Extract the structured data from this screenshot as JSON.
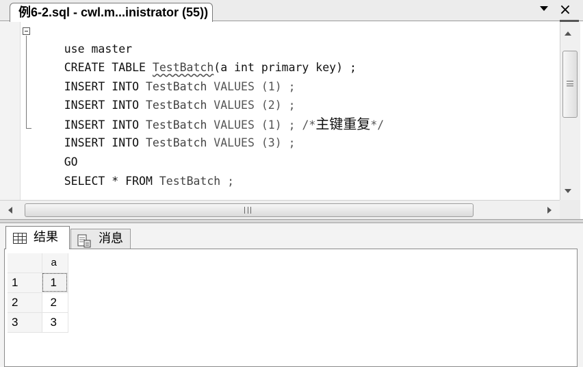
{
  "document_tab": {
    "title": "例6-2.sql - cwl.m...inistrator (55))"
  },
  "editor": {
    "lines": [
      {
        "kw": "use master"
      },
      {
        "kw": "CREATE TABLE ",
        "ident": "TestBatch",
        "rest": "(a int primary key) ;"
      },
      {
        "kw": "INSERT INTO ",
        "ident": "TestBatch",
        "rest": " VALUES (1) ;"
      },
      {
        "kw": "INSERT INTO ",
        "ident": "TestBatch",
        "rest": " VALUES (2) ;"
      },
      {
        "kw": "INSERT INTO ",
        "ident": "TestBatch",
        "rest": " VALUES (1) ; /*",
        "comment": "主键重复",
        "tail": "*/"
      },
      {
        "kw": "INSERT INTO ",
        "ident": "TestBatch",
        "rest": " VALUES (3) ;"
      },
      {
        "kw": "GO"
      },
      {
        "kw": "SELECT * FROM ",
        "ident": "TestBatch",
        "rest": " ;"
      }
    ]
  },
  "results": {
    "tabs": {
      "results_label": "结果",
      "messages_label": "消息"
    },
    "grid": {
      "columns": [
        "a"
      ],
      "rows": [
        {
          "num": "1",
          "values": [
            "1"
          ]
        },
        {
          "num": "2",
          "values": [
            "2"
          ]
        },
        {
          "num": "3",
          "values": [
            "3"
          ]
        }
      ]
    }
  },
  "icons": {
    "tab_dropdown": "chevron-down-icon",
    "tab_close": "close-icon",
    "fold": "collapse-icon",
    "results_tab": "grid-icon",
    "messages_tab": "message-icon"
  }
}
